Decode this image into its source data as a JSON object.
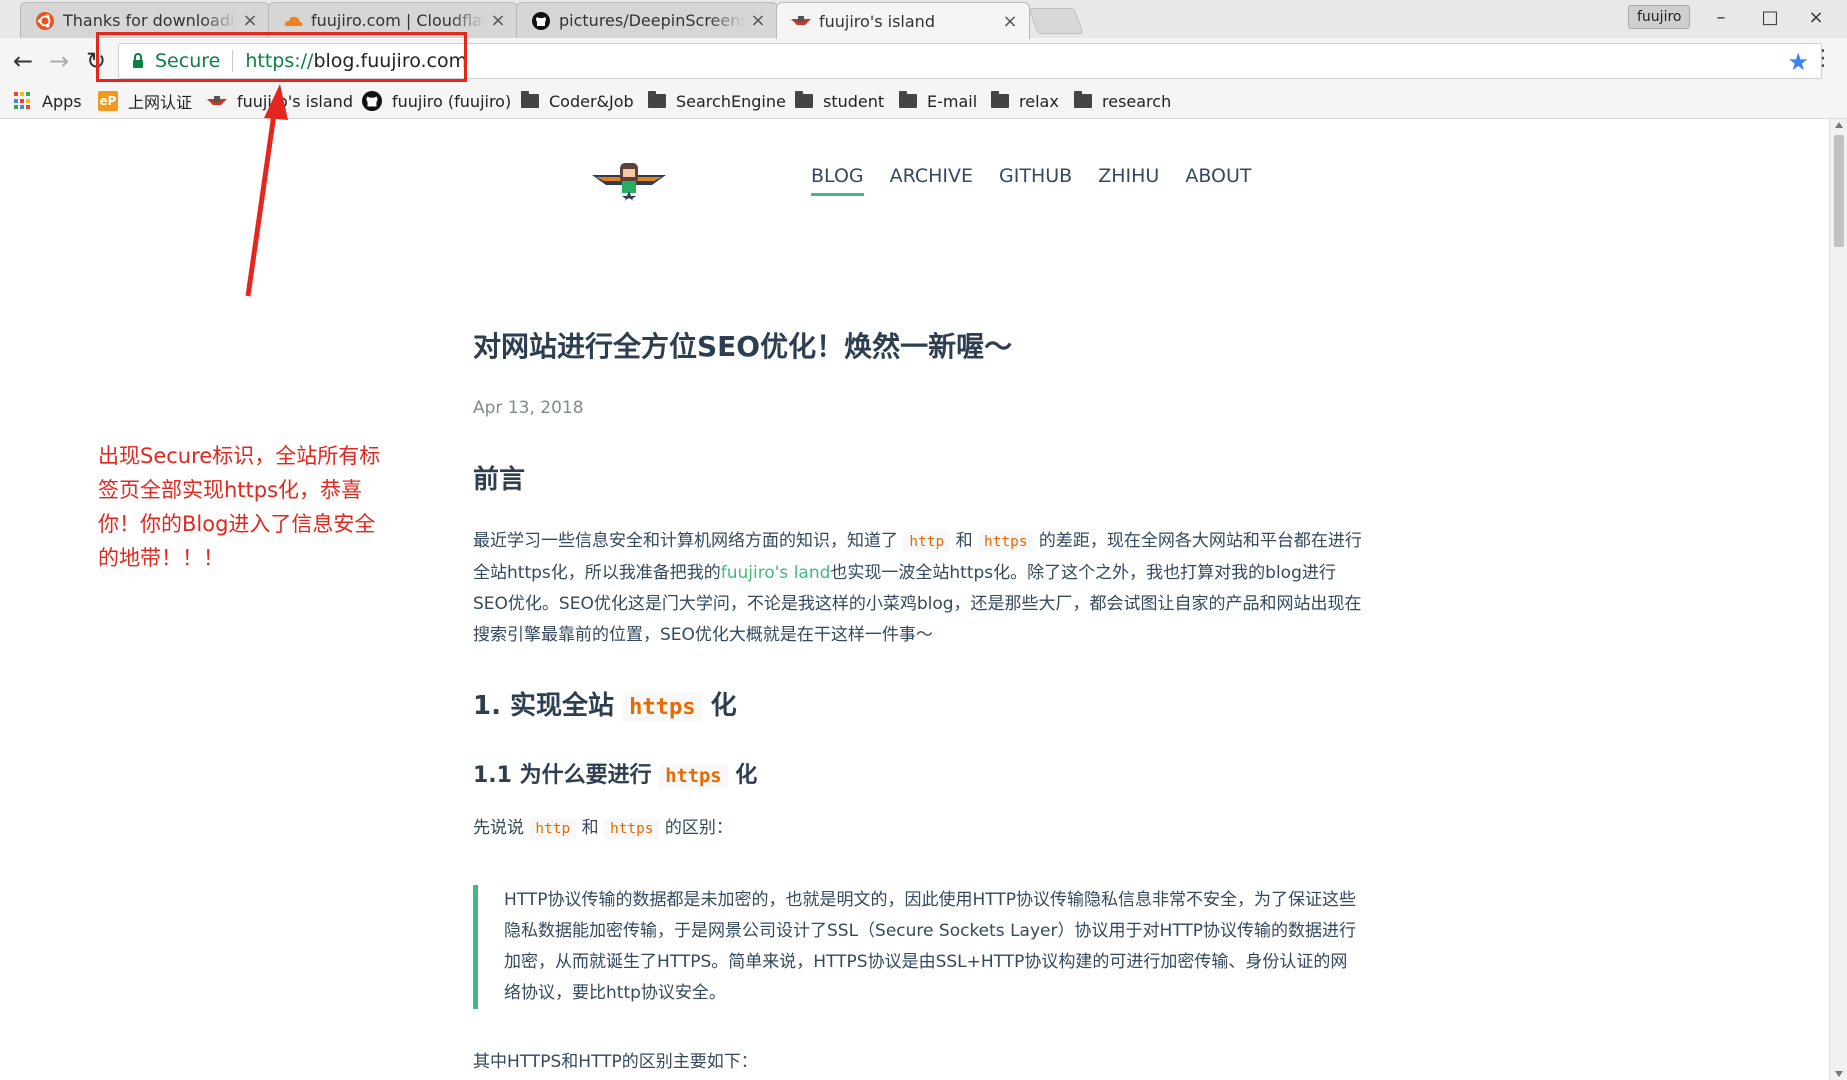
{
  "browser": {
    "tabs": [
      {
        "title": "Thanks for downloading",
        "favicon": "ubuntu-icon",
        "active": false
      },
      {
        "title": "fuujiro.com | Cloudflare",
        "favicon": "cloudflare-icon",
        "active": false
      },
      {
        "title": "pictures/DeepinScreenshot",
        "favicon": "github-icon",
        "active": false
      },
      {
        "title": "fuujiro's island",
        "favicon": "site-logo-icon",
        "active": true
      }
    ],
    "close_glyph": "×",
    "profile_name": "fuujiro",
    "window_controls": {
      "minimize": "–",
      "maximize": "□",
      "close": "×"
    },
    "address_bar": {
      "secure_label": "Secure",
      "scheme": "https://",
      "host": "blog.fuujiro.com"
    },
    "nav_glyphs": {
      "back": "←",
      "forward": "→",
      "reload": "↻",
      "star": "★",
      "menu": "⋮"
    },
    "bookmarks": [
      {
        "label": "Apps",
        "icon": "apps-grid-icon"
      },
      {
        "label": "上网认证",
        "icon": "ep-icon"
      },
      {
        "label": "fuujiro's island",
        "icon": "site-logo-icon"
      },
      {
        "label": "fuujiro (fuujiro)",
        "icon": "github-icon"
      },
      {
        "label": "Coder&Job",
        "icon": "folder-icon"
      },
      {
        "label": "SearchEngine",
        "icon": "folder-icon"
      },
      {
        "label": "student",
        "icon": "folder-icon"
      },
      {
        "label": "E-mail",
        "icon": "folder-icon"
      },
      {
        "label": "relax",
        "icon": "folder-icon"
      },
      {
        "label": "research",
        "icon": "folder-icon"
      }
    ]
  },
  "site": {
    "nav": [
      {
        "label": "BLOG",
        "active": true
      },
      {
        "label": "ARCHIVE",
        "active": false
      },
      {
        "label": "GITHUB",
        "active": false
      },
      {
        "label": "ZHIHU",
        "active": false
      },
      {
        "label": "ABOUT",
        "active": false
      }
    ]
  },
  "post": {
    "title": "对网站进行全方位SEO优化！焕然一新喔～",
    "date": "Apr 13, 2018",
    "section_preface": "前言",
    "preface": {
      "t1": "最近学习一些信息安全和计算机网络方面的知识，知道了 ",
      "c1": "http",
      "t2": " 和 ",
      "c2": "https",
      "t3": " 的差距，现在全网各大网站和平台都在进行全站https化，所以我准备把我的",
      "link": "fuujiro's land",
      "t4": "也实现一波全站https化。除了这个之外，我也打算对我的blog进行SEO优化。SEO优化这是门大学问，不论是我这样的小菜鸡blog，还是那些大厂，都会试图让自家的产品和网站出现在搜索引擎最靠前的位置，SEO优化大概就是在干这样一件事～"
    },
    "h2_1": {
      "prefix": "1. 实现全站 ",
      "code": "https",
      "suffix": " 化"
    },
    "h3_1": {
      "prefix": "1.1 为什么要进行 ",
      "code": "https",
      "suffix": " 化"
    },
    "diff_intro": {
      "t1": "先说说 ",
      "c1": "http",
      "t2": " 和 ",
      "c2": "https",
      "t3": " 的区别："
    },
    "quote": "HTTP协议传输的数据都是未加密的，也就是明文的，因此使用HTTP协议传输隐私信息非常不安全，为了保证这些隐私数据能加密传输，于是网景公司设计了SSL（Secure Sockets Layer）协议用于对HTTP协议传输的数据进行加密，从而就诞生了HTTPS。简单来说，HTTPS协议是由SSL+HTTP协议构建的可进行加密传输、身份认证的网络协议，要比http协议安全。",
    "diff_summary": "其中HTTPS和HTTP的区别主要如下："
  },
  "annotation": {
    "text": "出现Secure标识，全站所有标签页全部实现https化，恭喜你！你的Blog进入了信息安全的地带！！！",
    "color": "#e5261c"
  },
  "colors": {
    "accent": "#42b983",
    "code": "#e96900",
    "secure": "#0b8043",
    "annotation": "#e5261c"
  }
}
